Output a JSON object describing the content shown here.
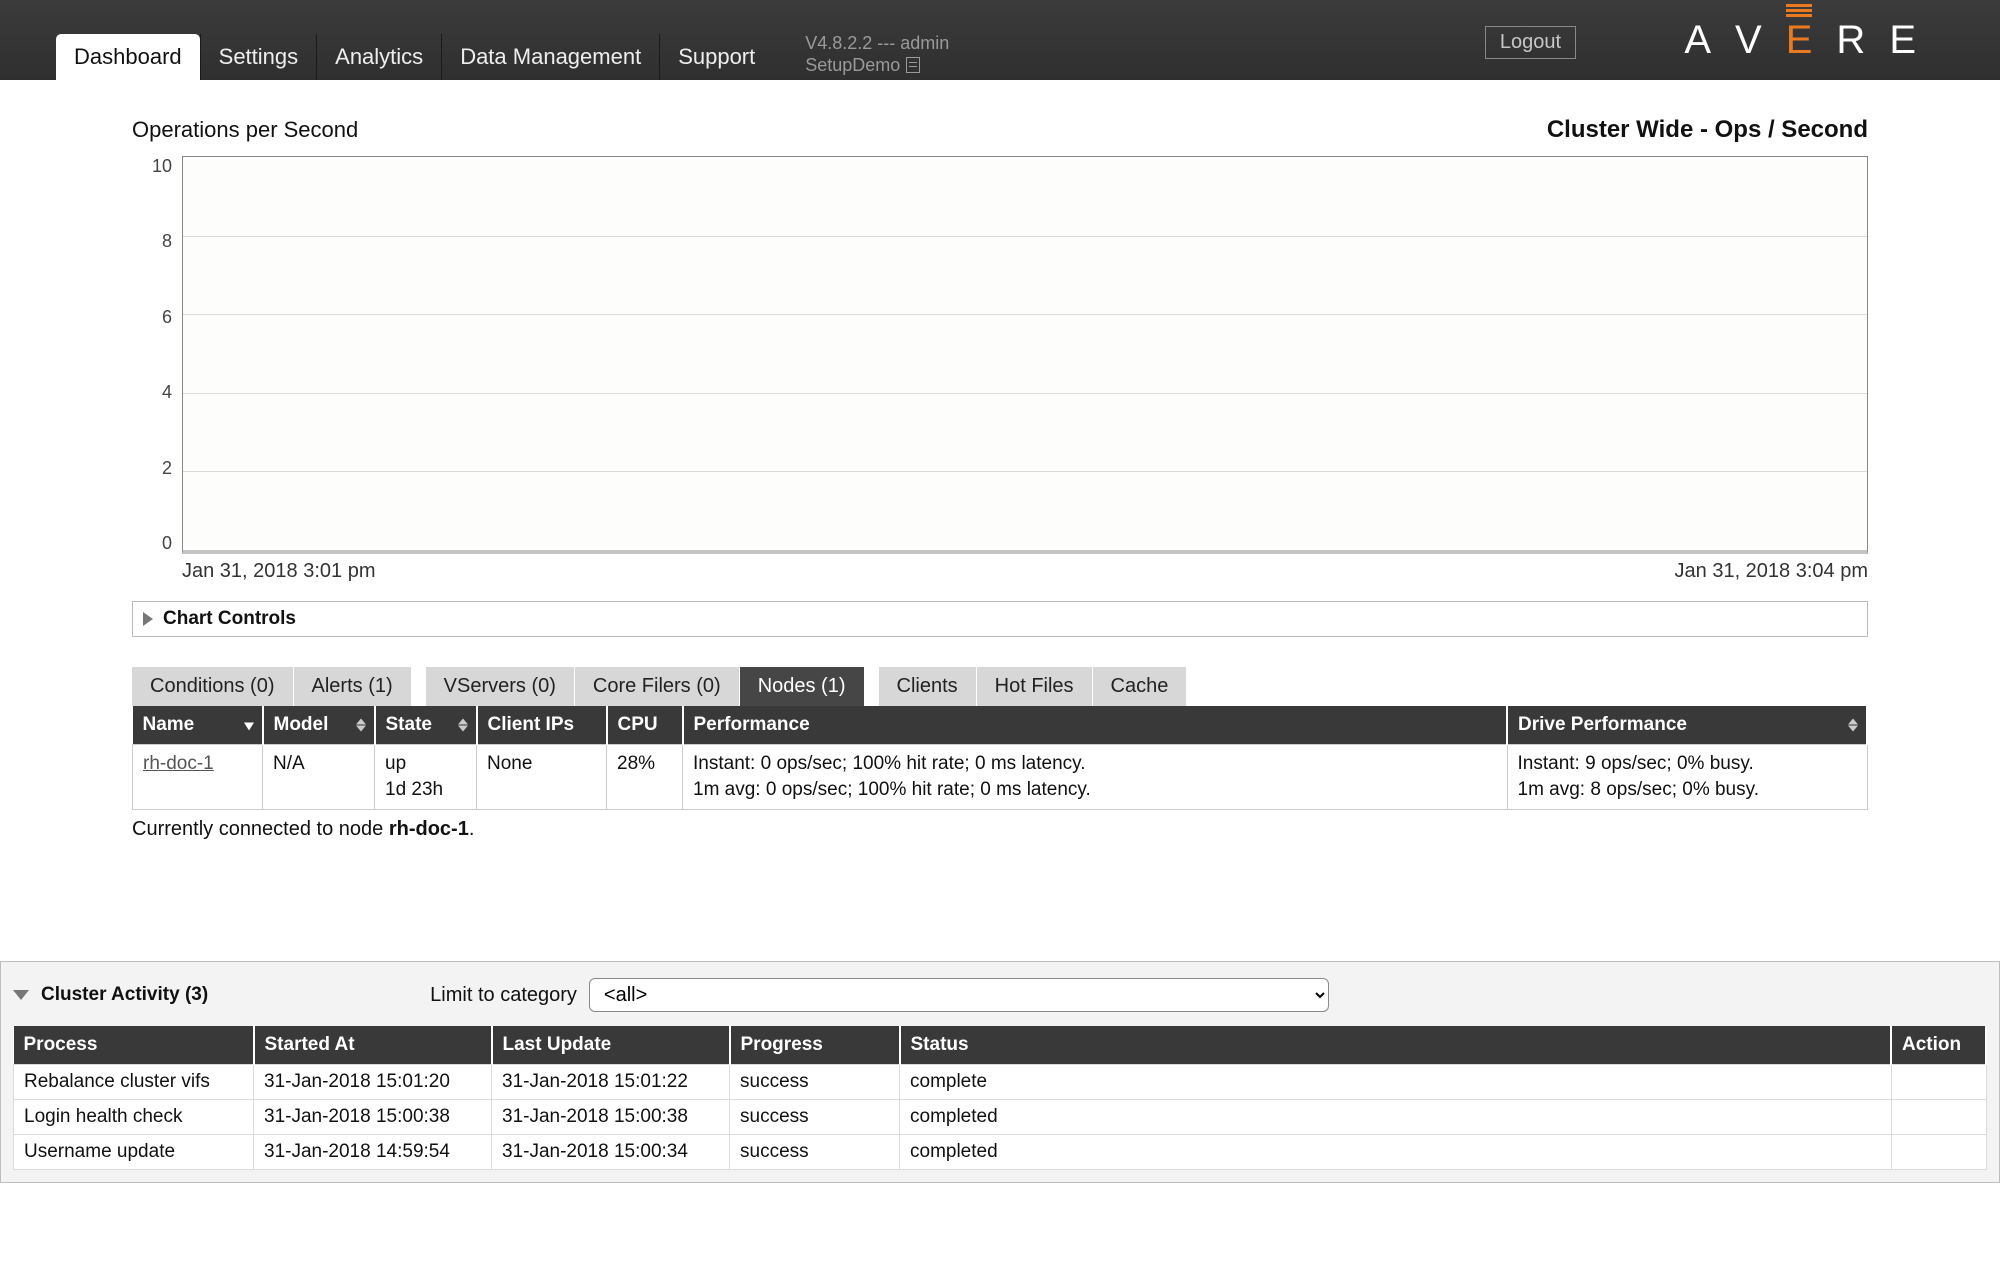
{
  "header": {
    "logout_label": "Logout",
    "logo_letters": [
      "A",
      "V",
      "E",
      "R",
      "E"
    ],
    "version_line": "V4.8.2.2 --- admin",
    "cluster_name": "SetupDemo",
    "tabs": [
      "Dashboard",
      "Settings",
      "Analytics",
      "Data Management",
      "Support"
    ],
    "active_tab_index": 0
  },
  "chart": {
    "left_title": "Operations per Second",
    "right_title": "Cluster Wide - Ops / Second",
    "controls_label": "Chart Controls",
    "x_left": "Jan 31, 2018 3:01 pm",
    "x_right": "Jan 31, 2018 3:04 pm"
  },
  "chart_data": {
    "type": "line",
    "title": "Cluster Wide - Ops / Second",
    "ylabel": "Operations per Second",
    "ylim": [
      0,
      10
    ],
    "y_ticks": [
      10,
      8,
      6,
      4,
      2,
      0
    ],
    "x_range": [
      "Jan 31, 2018 3:01 pm",
      "Jan 31, 2018 3:04 pm"
    ],
    "series": [
      {
        "name": "ops_per_second",
        "values": []
      }
    ]
  },
  "subtabs_left": [
    "Conditions (0)",
    "Alerts (1)"
  ],
  "subtabs_mid": [
    "VServers (0)",
    "Core Filers (0)",
    "Nodes (1)"
  ],
  "subtabs_mid_active_index": 2,
  "subtabs_right": [
    "Clients",
    "Hot Files",
    "Cache"
  ],
  "node_table": {
    "headers": [
      "Name",
      "Model",
      "State",
      "Client IPs",
      "CPU",
      "Performance",
      "Drive Performance"
    ],
    "row": {
      "name": "rh-doc-1",
      "model": "N/A",
      "state": "up\n1d 23h",
      "client_ips": "None",
      "cpu": "28%",
      "perf": "Instant:  0 ops/sec; 100% hit rate; 0 ms latency.\n1m avg: 0 ops/sec; 100% hit rate; 0 ms latency.",
      "drive": "Instant:   9 ops/sec;  0% busy.\n1m avg:  8 ops/sec;  0% busy."
    },
    "connected_prefix": "Currently connected to node ",
    "connected_node": "rh-doc-1",
    "connected_suffix": "."
  },
  "activity": {
    "title": "Cluster Activity (3)",
    "limit_label": "Limit to category",
    "category_value": "<all>",
    "headers": [
      "Process",
      "Started At",
      "Last Update",
      "Progress",
      "Status",
      "Action"
    ],
    "rows": [
      {
        "process": "Rebalance cluster vifs",
        "started": "31-Jan-2018 15:01:20",
        "last": "31-Jan-2018 15:01:22",
        "progress": "success",
        "status": "complete"
      },
      {
        "process": "Login health check",
        "started": "31-Jan-2018 15:00:38",
        "last": "31-Jan-2018 15:00:38",
        "progress": "success",
        "status": "completed"
      },
      {
        "process": "Username update",
        "started": "31-Jan-2018 14:59:54",
        "last": "31-Jan-2018 15:00:34",
        "progress": "success",
        "status": "completed"
      }
    ]
  }
}
